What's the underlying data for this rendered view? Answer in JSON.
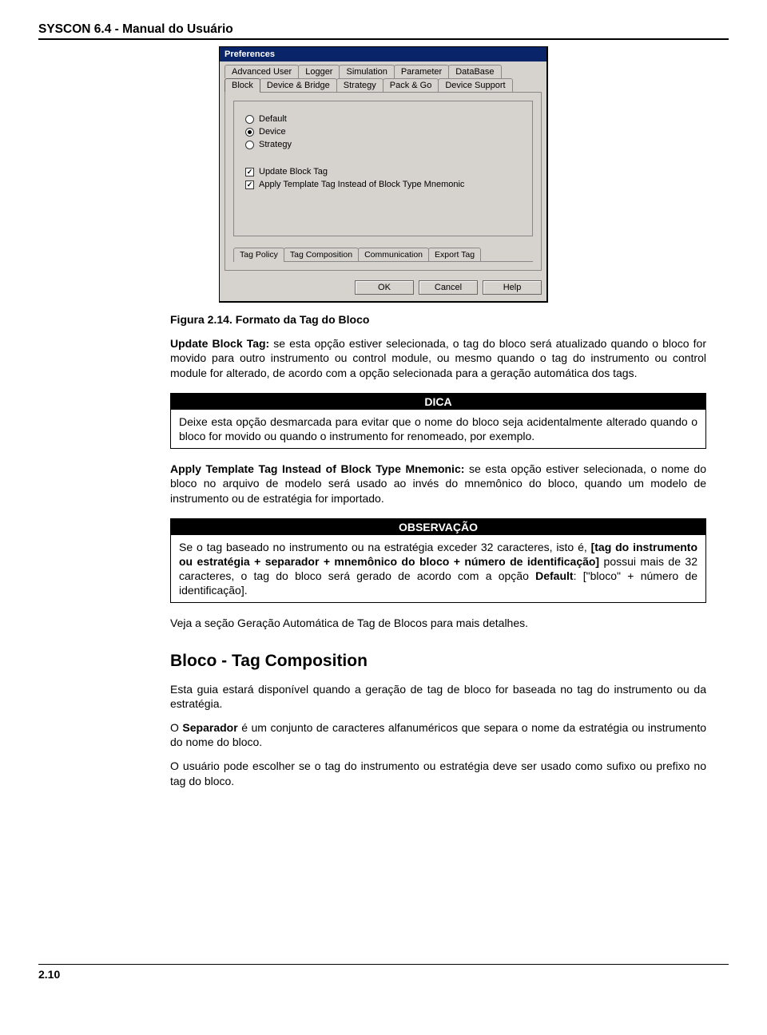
{
  "header": {
    "title": "SYSCON 6.4 - Manual do Usuário"
  },
  "dialog": {
    "title": "Preferences",
    "topTabs": [
      "Advanced User",
      "Logger",
      "Simulation",
      "Parameter",
      "DataBase"
    ],
    "mainTabs": [
      "Block",
      "Device & Bridge",
      "Strategy",
      "Pack & Go",
      "Device Support"
    ],
    "radios": {
      "default": "Default",
      "device": "Device",
      "strategy": "Strategy",
      "selected": "device"
    },
    "checks": {
      "updateTag": {
        "label": "Update Block Tag",
        "checked": true
      },
      "applyTemplate": {
        "label": "Apply Template Tag Instead of Block Type Mnemonic",
        "checked": true
      }
    },
    "innerTabs": [
      "Tag Policy",
      "Tag Composition",
      "Communication",
      "Export Tag"
    ],
    "buttons": {
      "ok": "OK",
      "cancel": "Cancel",
      "help": "Help"
    }
  },
  "caption": "Figura 2.14. Formato da Tag do Bloco",
  "para1_pre": "Update Block Tag:",
  "para1_post": " se esta opção estiver selecionada, o tag do bloco será atualizado quando o bloco for movido para outro instrumento ou control module, ou mesmo quando o tag do instrumento ou control module for alterado, de acordo com a opção selecionada para a geração automática dos tags.",
  "dica": {
    "title": "DICA",
    "body": "Deixe esta opção desmarcada para evitar que o nome do bloco seja acidentalmente alterado quando o bloco for movido ou quando o instrumento for renomeado, por exemplo."
  },
  "para2_pre": "Apply Template Tag Instead of Block Type Mnemonic:",
  "para2_post": " se esta opção estiver selecionada, o nome do bloco no arquivo de modelo será usado ao invés do mnemônico do bloco, quando um modelo de instrumento ou de estratégia for importado.",
  "obs": {
    "title": "OBSERVAÇÃO",
    "pre": "Se o tag baseado no instrumento ou na estratégia exceder 32 caracteres, isto é, ",
    "bold": "[tag do instrumento ou estratégia + separador + mnemônico do bloco + número de identificação]",
    "mid": " possui mais de 32 caracteres, o tag do bloco será gerado de acordo com a opção ",
    "bold2": "Default",
    "post": ": [\"bloco\" + número de identificação]."
  },
  "seeMore": "Veja a seção Geração Automática de Tag de Blocos para mais detalhes.",
  "section2": {
    "title": "Bloco - Tag Composition",
    "p1": "Esta guia estará disponível quando a geração de tag de bloco for baseada no tag do instrumento ou da estratégia.",
    "p2_pre": "O ",
    "p2_bold": "Separador",
    "p2_post": " é um conjunto de caracteres alfanuméricos que separa o nome da estratégia ou instrumento do nome do bloco.",
    "p3": "O usuário pode escolher se o tag do instrumento ou estratégia deve ser usado como sufixo ou prefixo no tag do bloco."
  },
  "footer": {
    "pageNum": "2.10"
  }
}
